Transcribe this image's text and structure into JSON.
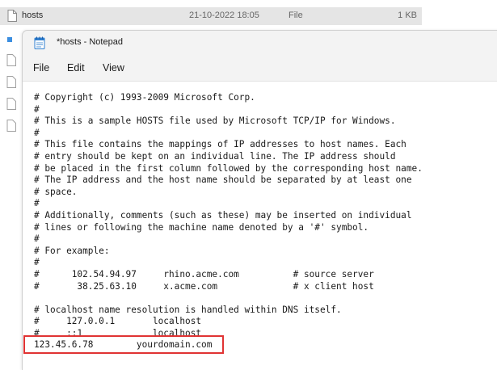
{
  "explorer": {
    "file_name": "hosts",
    "modified": "21-10-2022 18:05",
    "type": "File",
    "size": "1 KB"
  },
  "notepad": {
    "title": "*hosts - Notepad",
    "menu": [
      "File",
      "Edit",
      "View"
    ],
    "content": "# Copyright (c) 1993-2009 Microsoft Corp.\n#\n# This is a sample HOSTS file used by Microsoft TCP/IP for Windows.\n#\n# This file contains the mappings of IP addresses to host names. Each\n# entry should be kept on an individual line. The IP address should\n# be placed in the first column followed by the corresponding host name.\n# The IP address and the host name should be separated by at least one\n# space.\n#\n# Additionally, comments (such as these) may be inserted on individual\n# lines or following the machine name denoted by a '#' symbol.\n#\n# For example:\n#\n#      102.54.94.97     rhino.acme.com          # source server\n#       38.25.63.10     x.acme.com              # x client host\n\n# localhost name resolution is handled within DNS itself.\n#     127.0.0.1       localhost\n#     ::1             localhost\n123.45.6.78        yourdomain.com"
  },
  "colors": {
    "highlight": "#e03333",
    "notepad_icon": "#2f7fd0"
  },
  "icons": {
    "explorer_file": "file-icon",
    "notepad": "notepad-icon"
  }
}
